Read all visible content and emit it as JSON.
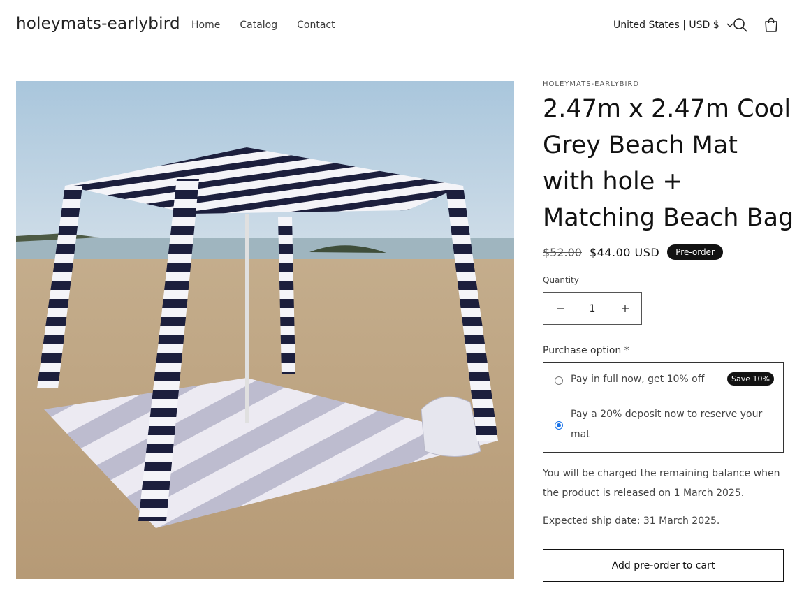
{
  "header": {
    "logo": "holeymats-earlybird",
    "nav": [
      "Home",
      "Catalog",
      "Contact"
    ],
    "country": "United States | USD $"
  },
  "product": {
    "vendor": "HOLEYMATS-EARLYBIRD",
    "title": "2.47m x 2.47m Cool Grey Beach Mat with hole + Matching Beach Bag",
    "price_regular": "$52.00",
    "price_sale": "$44.00 USD",
    "badge": "Pre-order",
    "quantity_label": "Quantity",
    "quantity_value": "1",
    "purchase_option_label": "Purchase option *",
    "options": [
      {
        "label": "Pay in full now, get 10% off",
        "badge": "Save 10%",
        "selected": false
      },
      {
        "label": "Pay a 20% deposit now to reserve your mat",
        "selected": true
      }
    ],
    "note_balance": "You will be charged the remaining balance when the product is released on 1 March 2025.",
    "note_ship": "Expected ship date: 31 March 2025.",
    "add_button": "Add pre-order to cart"
  }
}
